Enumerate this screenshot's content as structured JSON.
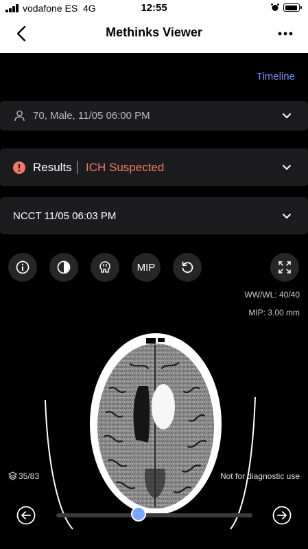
{
  "status_bar": {
    "carrier": "vodafone ES",
    "network": "4G",
    "time": "12:55"
  },
  "nav": {
    "title": "Methinks Viewer"
  },
  "timeline_label": "Timeline",
  "patient": {
    "summary": "70, Male, 11/05 06:00 PM"
  },
  "results": {
    "label": "Results",
    "finding": "ICH Suspected",
    "finding_color": "#f27a66"
  },
  "study": {
    "label": "NCCT 11/05 06:03 PM"
  },
  "toolbar": {
    "mip_label": "MIP"
  },
  "overlay": {
    "window": "WW/WL: 40/40",
    "mip": "MIP: 3.00 mm",
    "slice": "35/83",
    "disclaimer": "Not for diagnostic use"
  },
  "slider": {
    "current_slice": 35,
    "total_slices": 83,
    "position_fraction": 0.42
  },
  "colors": {
    "accent": "#7a8cf0",
    "panel": "#1c1c1e",
    "slider_knob": "#7aa6ff"
  }
}
